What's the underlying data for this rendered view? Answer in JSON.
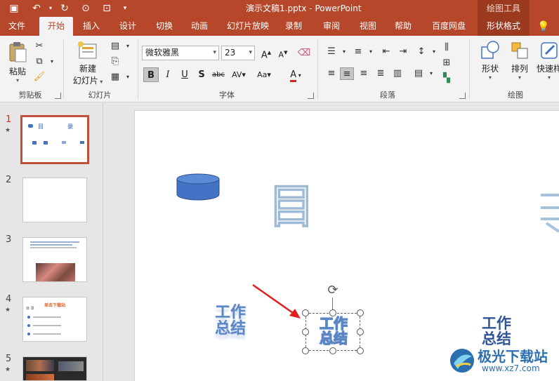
{
  "window": {
    "title": "演示文稿1.pptx  -  PowerPoint",
    "contextual_tool": "绘图工具"
  },
  "tabs": [
    "文件",
    "开始",
    "插入",
    "设计",
    "切换",
    "动画",
    "幻灯片放映",
    "录制",
    "审阅",
    "视图",
    "帮助",
    "百度网盘",
    "形状格式"
  ],
  "active_tab": "开始",
  "ribbon": {
    "clipboard": {
      "paste": "粘贴",
      "label": "剪贴板"
    },
    "slides": {
      "new_slide_line1": "新建",
      "new_slide_line2": "幻灯片",
      "label": "幻灯片"
    },
    "font": {
      "name": "微软雅黑",
      "size": "23",
      "label": "字体"
    },
    "paragraph": {
      "label": "段落"
    },
    "drawing": {
      "shape": "形状",
      "arrange": "排列",
      "quick_styles": "快速样",
      "label": "绘图"
    }
  },
  "slides_pane": {
    "items": [
      {
        "num": "1",
        "star": "★",
        "active": true,
        "title_left": "目",
        "title_right": "录"
      },
      {
        "num": "2",
        "star": "",
        "active": false
      },
      {
        "num": "3",
        "star": "",
        "active": false
      },
      {
        "num": "4",
        "star": "★",
        "active": false,
        "heading": "单击下载站",
        "mu": "目 录"
      },
      {
        "num": "5",
        "star": "★",
        "active": false
      }
    ]
  },
  "slide": {
    "title_char_1": "目",
    "wordart_1": "工作\n总结",
    "wordart_2": "工作\n总结",
    "wordart_3": "工作\n总结"
  },
  "watermark": {
    "brand": "极光下载站",
    "url": "www.xz7.com"
  },
  "colors": {
    "accent": "#b7472a",
    "wordart_blue": "#4a72b8",
    "cylinder": "#4472c4",
    "arrow": "#e02020"
  }
}
